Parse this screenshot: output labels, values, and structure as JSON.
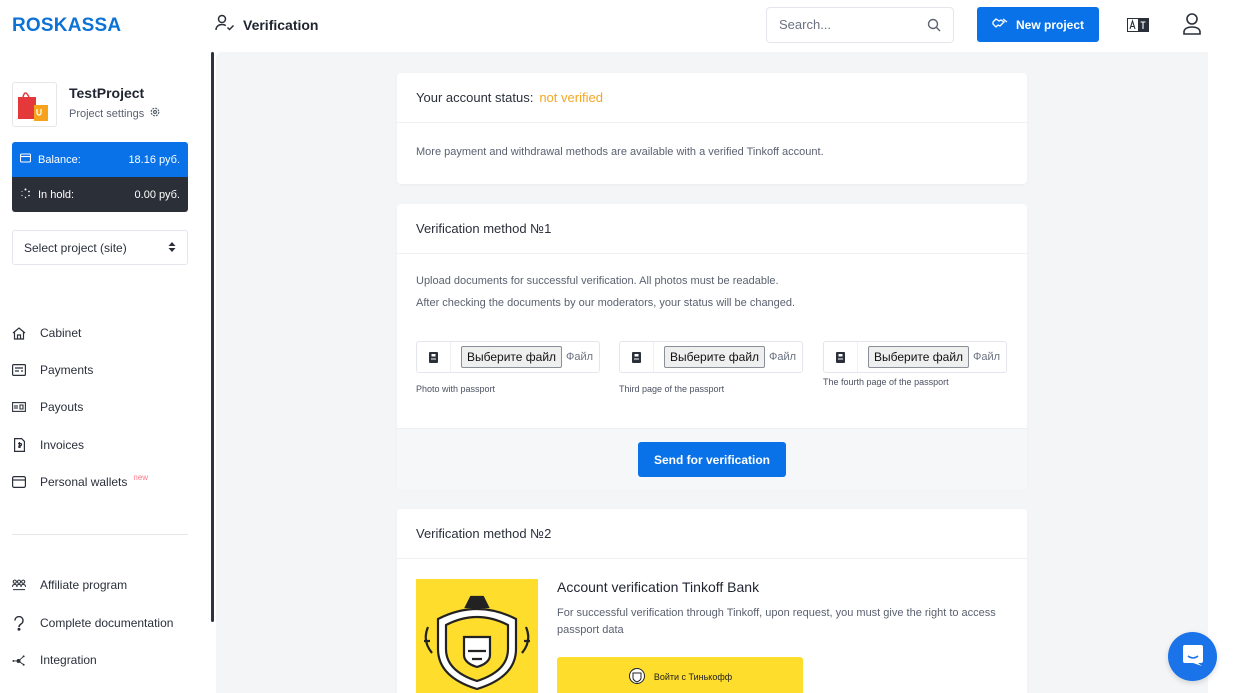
{
  "brand": {
    "logo": "ROSKASSA",
    "accent": "#0a72e8"
  },
  "header": {
    "title": "Verification",
    "search_placeholder": "Search...",
    "new_project_label": "New project"
  },
  "sidebar": {
    "project": {
      "name": "TestProject",
      "settings_label": "Project settings"
    },
    "balance": {
      "label": "Balance:",
      "value": "18.16 руб."
    },
    "hold": {
      "label": "In hold:",
      "value": "0.00 руб."
    },
    "project_select": "Select project (site)",
    "nav": [
      {
        "label": "Cabinet",
        "icon": "home-icon"
      },
      {
        "label": "Payments",
        "icon": "payments-icon"
      },
      {
        "label": "Payouts",
        "icon": "payouts-icon"
      },
      {
        "label": "Invoices",
        "icon": "invoice-icon"
      },
      {
        "label": "Personal wallets",
        "icon": "wallet-icon",
        "badge": "new"
      }
    ],
    "bottom_nav": [
      {
        "label": "Affiliate program",
        "icon": "affiliate-icon"
      },
      {
        "label": "Complete documentation",
        "icon": "documentation-icon"
      },
      {
        "label": "Integration",
        "icon": "integration-icon"
      }
    ]
  },
  "status_card": {
    "label": "Your account status:",
    "value": "not verified",
    "value_color": "#f5a623",
    "info": "More payment and withdrawal methods are available with a verified Tinkoff account."
  },
  "method1": {
    "title": "Verification method №1",
    "text1": "Upload documents for successful verification. All photos must be readable.",
    "text2": "After checking the documents by our moderators, your status will be changed.",
    "file_button": "Выберите файл",
    "file_none": "Файл не выбран",
    "uploads": [
      {
        "label": "Photo with passport"
      },
      {
        "label": "Third page of the passport"
      },
      {
        "label": "The fourth page of the passport"
      }
    ],
    "submit_label": "Send for verification"
  },
  "method2": {
    "title": "Verification method №2",
    "heading": "Account verification Tinkoff Bank",
    "text": "For successful verification through Tinkoff, upon request, you must give the right to access passport data",
    "button_label": "Войти с Тинькофф",
    "brand_color": "#ffdd2d"
  }
}
